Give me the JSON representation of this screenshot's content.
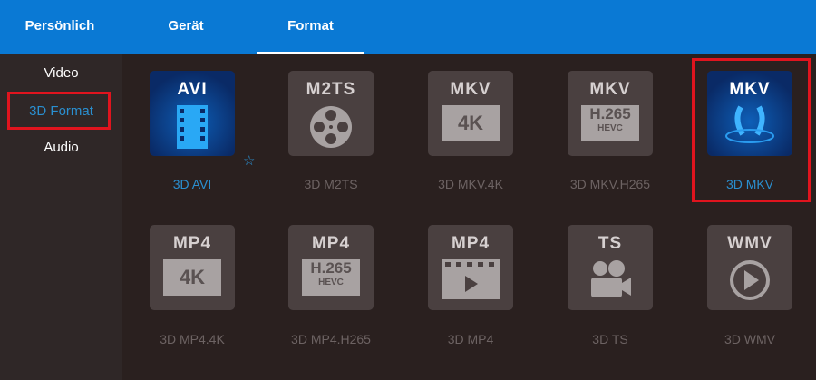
{
  "header": {
    "tabs": [
      {
        "label": "Persönlich"
      },
      {
        "label": "Gerät"
      },
      {
        "label": "Format",
        "active": true
      }
    ]
  },
  "sidebar": {
    "items": [
      {
        "label": "Video"
      },
      {
        "label": "3D Format",
        "selected": true
      },
      {
        "label": "Audio"
      }
    ]
  },
  "formats": [
    {
      "icon_text": "AVI",
      "label": "3D AVI",
      "selected": true,
      "favorite_icon": "star-icon"
    },
    {
      "icon_text": "M2TS",
      "label": "3D M2TS"
    },
    {
      "icon_text": "MKV",
      "badge": "4K",
      "label": "3D MKV.4K"
    },
    {
      "icon_text": "MKV",
      "badge": "H.265",
      "badge_sub": "HEVC",
      "label": "3D MKV.H265"
    },
    {
      "icon_text": "MKV",
      "label": "3D MKV",
      "selected": true
    },
    {
      "icon_text": "MP4",
      "badge": "4K",
      "label": "3D MP4.4K"
    },
    {
      "icon_text": "MP4",
      "badge": "H.265",
      "badge_sub": "HEVC",
      "label": "3D MP4.H265"
    },
    {
      "icon_text": "MP4",
      "label": "3D MP4"
    },
    {
      "icon_text": "TS",
      "label": "3D TS"
    },
    {
      "icon_text": "WMV",
      "label": "3D WMV"
    }
  ],
  "colors": {
    "header": "#0a79d4",
    "accent": "#2a8fd0",
    "highlight": "#e0141e"
  }
}
